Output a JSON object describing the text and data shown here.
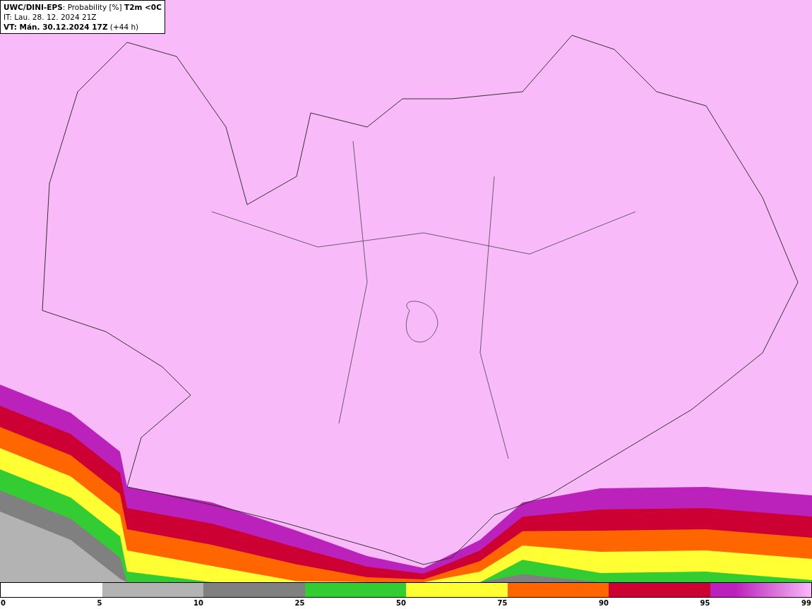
{
  "header": {
    "lines": [
      "**UWC/DINI-EPS**: Probability [%] **T2m <0C**",
      "IT: Lau. 28. 12. 2024 21Z",
      "**VT: Mán. 30.12.2024 17Z** (+44 h)"
    ]
  },
  "legend": {
    "segments": [
      {
        "color": "#b3b3b3"
      },
      {
        "color": "#808080"
      },
      {
        "color": "#33cc33"
      },
      {
        "color": "#ffff33"
      },
      {
        "color": "#ff6600"
      },
      {
        "color": "#cc0033"
      },
      {
        "color": "#bb22bb"
      }
    ],
    "labels": [
      "0",
      "5",
      "10",
      "25",
      "50",
      "75",
      "90",
      "95",
      "99"
    ]
  }
}
